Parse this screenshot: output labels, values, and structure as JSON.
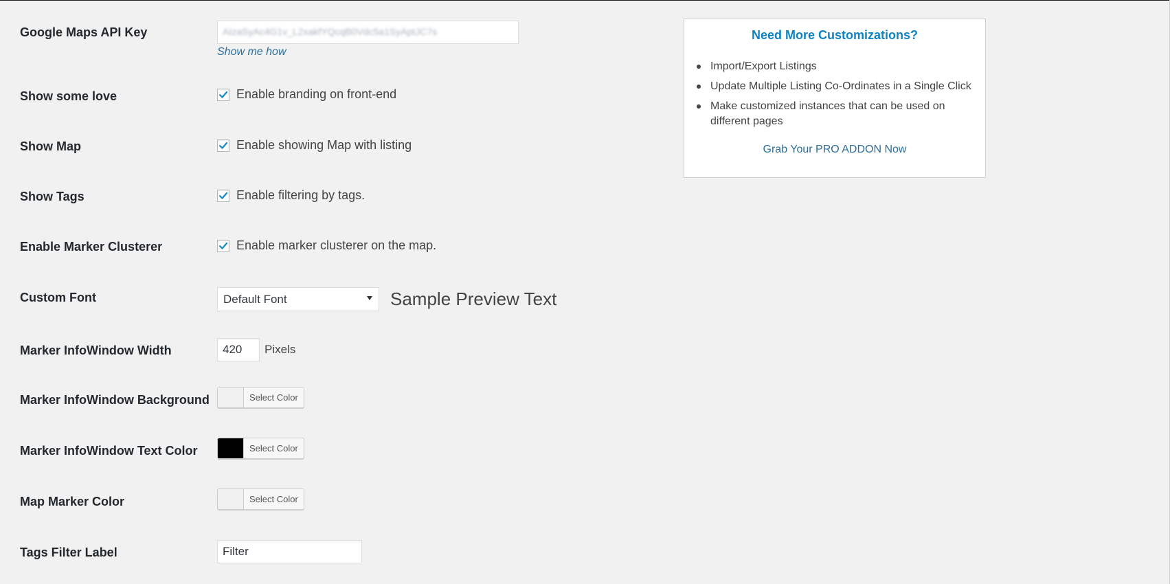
{
  "settings": {
    "api_key": {
      "label": "Google Maps API Key",
      "value": "AIzaSyAc4G1v_L2xakfYQcqB0Vdc5a1SyAptJC7s",
      "help_link": "Show me how"
    },
    "show_some_love": {
      "label": "Show some love",
      "checked": true,
      "option": "Enable branding on front-end"
    },
    "show_map": {
      "label": "Show Map",
      "checked": true,
      "option": "Enable showing Map with listing"
    },
    "show_tags": {
      "label": "Show Tags",
      "checked": true,
      "option": "Enable filtering by tags."
    },
    "marker_clusterer": {
      "label": "Enable Marker Clusterer",
      "checked": true,
      "option": "Enable marker clusterer on the map."
    },
    "custom_font": {
      "label": "Custom Font",
      "selected": "Default Font",
      "preview": "Sample Preview Text"
    },
    "infowindow_width": {
      "label": "Marker InfoWindow Width",
      "value": "420",
      "unit": "Pixels"
    },
    "infowindow_background": {
      "label": "Marker InfoWindow Background",
      "button": "Select Color",
      "color": "#f1f1f1"
    },
    "infowindow_text_color": {
      "label": "Marker InfoWindow Text Color",
      "button": "Select Color",
      "color": "#000000"
    },
    "map_marker_color": {
      "label": "Map Marker Color",
      "button": "Select Color",
      "color": "#f1f1f1"
    },
    "tags_filter_label": {
      "label": "Tags Filter Label",
      "value": "Filter"
    }
  },
  "promo": {
    "title": "Need More Customizations?",
    "items": [
      "Import/Export Listings",
      "Update Multiple Listing Co-Ordinates in a Single Click",
      "Make customized instances that can be used on different pages"
    ],
    "cta": "Grab Your PRO ADDON Now"
  },
  "colors": {
    "page_background": "#f1f1f1",
    "link": "#2b6e9a",
    "promo_title": "#0f83c1",
    "checkmark": "#1e8cbe"
  }
}
